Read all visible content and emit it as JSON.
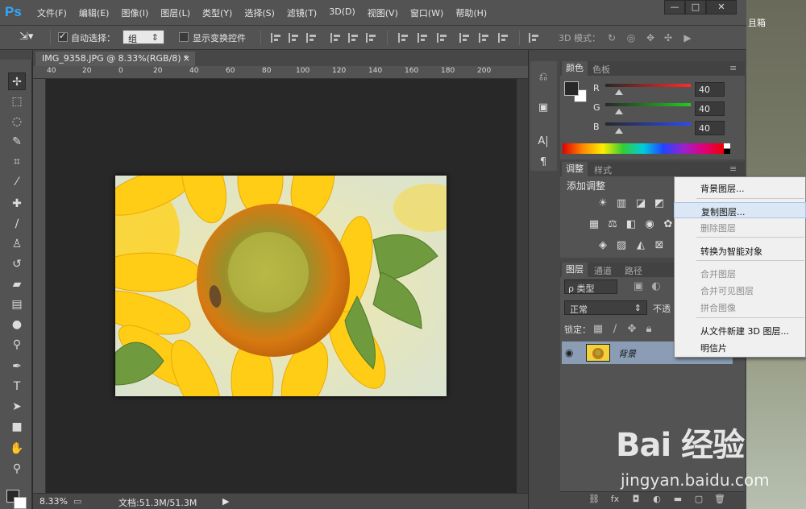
{
  "app": {
    "logo": "Ps",
    "menu": [
      "文件(F)",
      "编辑(E)",
      "图像(I)",
      "图层(L)",
      "类型(Y)",
      "选择(S)",
      "滤镜(T)",
      "3D(D)",
      "视图(V)",
      "窗口(W)",
      "帮助(H)"
    ],
    "window_controls": [
      "—",
      "□",
      "✕"
    ]
  },
  "options_bar": {
    "auto_select_label": "自动选择：",
    "auto_select_value": "组",
    "show_transform_label": "显示变换控件",
    "mode_3d_label": "3D 模式："
  },
  "document": {
    "tab_title": "IMG_9358.JPG @ 8.33%(RGB/8) *",
    "tab_close": "×",
    "ruler_labels": [
      "40",
      "20",
      "0",
      "20",
      "40",
      "60",
      "80",
      "100",
      "120",
      "140",
      "160",
      "180",
      "200"
    ],
    "zoom": "8.33%",
    "doc_info": "文档:51.3M/51.3M"
  },
  "color_panel": {
    "tabs": [
      "颜色",
      "色板"
    ],
    "channels": [
      {
        "label": "R",
        "value": "40",
        "color": "#ff2a2a"
      },
      {
        "label": "G",
        "value": "40",
        "color": "#22cc22"
      },
      {
        "label": "B",
        "value": "40",
        "color": "#2a4aff"
      }
    ],
    "foreground_color": "#282828",
    "background_color": "#ffffff"
  },
  "adjustments_panel": {
    "tabs": [
      "调整",
      "样式"
    ],
    "heading": "添加调整"
  },
  "layers_panel": {
    "tabs": [
      "图层",
      "通道",
      "路径"
    ],
    "filter_kind": "ρ 类型",
    "blend_mode": "正常",
    "opacity_label": "不透",
    "lock_label": "锁定：",
    "layer_name": "背景"
  },
  "context_menu": {
    "items": [
      {
        "label": "背景图层...",
        "disabled": false,
        "hover": false
      },
      {
        "label": "复制图层...",
        "disabled": false,
        "hover": true
      },
      {
        "label": "删除图层",
        "disabled": true,
        "hover": false
      },
      {
        "label": "转换为智能对象",
        "disabled": false,
        "hover": false
      },
      {
        "label": "合并图层",
        "disabled": true,
        "hover": false
      },
      {
        "label": "合并可见图层",
        "disabled": true,
        "hover": false
      },
      {
        "label": "拼合图像",
        "disabled": true,
        "hover": false
      },
      {
        "label": "从文件新建 3D 图层...",
        "disabled": false,
        "hover": false
      },
      {
        "label": "明信片",
        "disabled": false,
        "hover": false
      }
    ]
  },
  "desktop": {
    "label": "且箱"
  },
  "watermark": {
    "logo": "Bai 经验",
    "url": "jingyan.baidu.com"
  }
}
